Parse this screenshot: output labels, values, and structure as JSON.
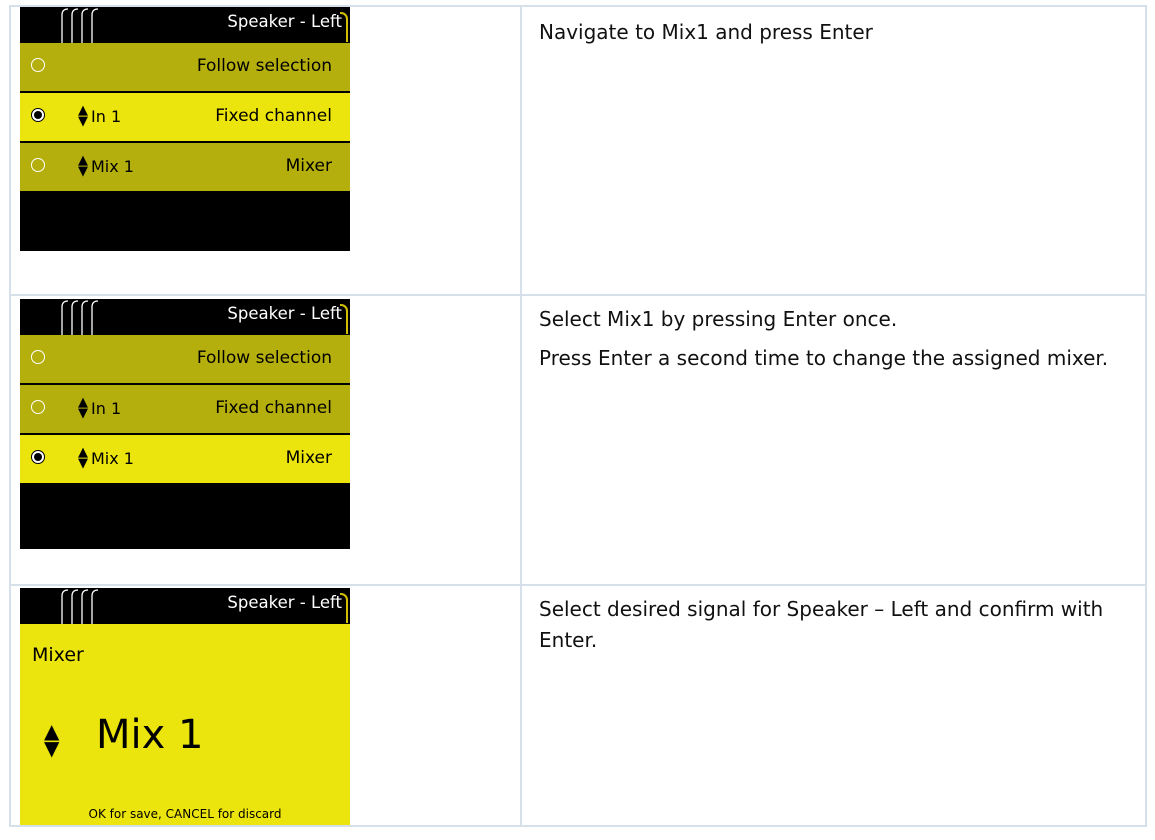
{
  "steps": [
    {
      "screen": {
        "title": "Speaker - Left",
        "rows": [
          {
            "label": "Follow selection",
            "channel": "",
            "selected": false
          },
          {
            "label": "Fixed channel",
            "channel": "In 1",
            "selected": true
          },
          {
            "label": "Mixer",
            "channel": "Mix 1",
            "selected": false
          }
        ]
      },
      "text": [
        "Navigate to Mix1 and press Enter"
      ]
    },
    {
      "screen": {
        "title": "Speaker - Left",
        "rows": [
          {
            "label": "Follow selection",
            "channel": "",
            "selected": false
          },
          {
            "label": "Fixed channel",
            "channel": "In 1",
            "selected": false
          },
          {
            "label": "Mixer",
            "channel": "Mix 1",
            "selected": true
          }
        ]
      },
      "text": [
        "Select Mix1 by pressing Enter once.",
        "Press Enter a second time to change the assigned mixer."
      ]
    },
    {
      "screen": {
        "title": "Speaker - Left",
        "heading": "Mixer",
        "value": "Mix 1",
        "hint": "OK for save, CANCEL for discard"
      },
      "text": [
        "Select desired signal for Speaker – Left and confirm with Enter."
      ]
    }
  ],
  "icons": {
    "updown": "up-down-arrow-icon",
    "radio": "radio-button-icon"
  },
  "colors": {
    "row_selected": "#ece50d",
    "row_normal": "#b5af0e",
    "screen_bg": "#000000"
  }
}
